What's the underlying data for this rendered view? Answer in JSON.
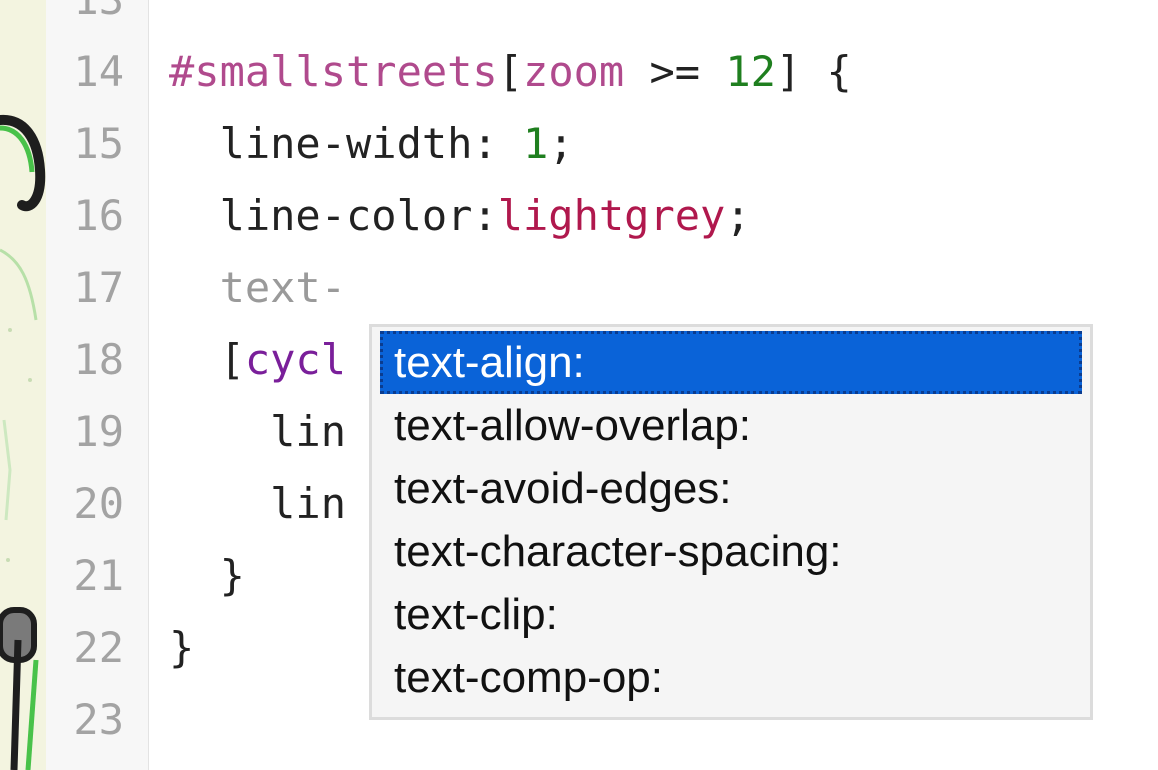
{
  "editor": {
    "line_numbers": [
      "13",
      "14",
      "15",
      "16",
      "17",
      "18",
      "19",
      "20",
      "21",
      "22",
      "23"
    ],
    "lines": {
      "l14": {
        "selector": "#smallstreets",
        "open": "[",
        "key": "zoom",
        "op": " >= ",
        "num": "12",
        "close": "] {"
      },
      "l15": {
        "prop": "  line-width: ",
        "num": "1",
        "end": ";"
      },
      "l16": {
        "prop": "  line-color:",
        "value": "lightgrey",
        "end": ";"
      },
      "l17": {
        "partial": "  text-"
      },
      "l18": {
        "indent": "  [",
        "cond": "cycl"
      },
      "l19": {
        "text": "    lin"
      },
      "l20": {
        "text": "    lin"
      },
      "l21": {
        "text": "  }"
      },
      "l22": {
        "text": "}"
      }
    }
  },
  "autocomplete": {
    "items": [
      "text-align:",
      "text-allow-overlap:",
      "text-avoid-edges:",
      "text-character-spacing:",
      "text-clip:",
      "text-comp-op:"
    ],
    "selected_index": 0
  },
  "colors": {
    "selected_bg": "#0a63d8",
    "gutter_bg": "#f7f7f7",
    "selector": "#b04a8d",
    "number": "#1f7f1f",
    "value": "#b0184d"
  }
}
